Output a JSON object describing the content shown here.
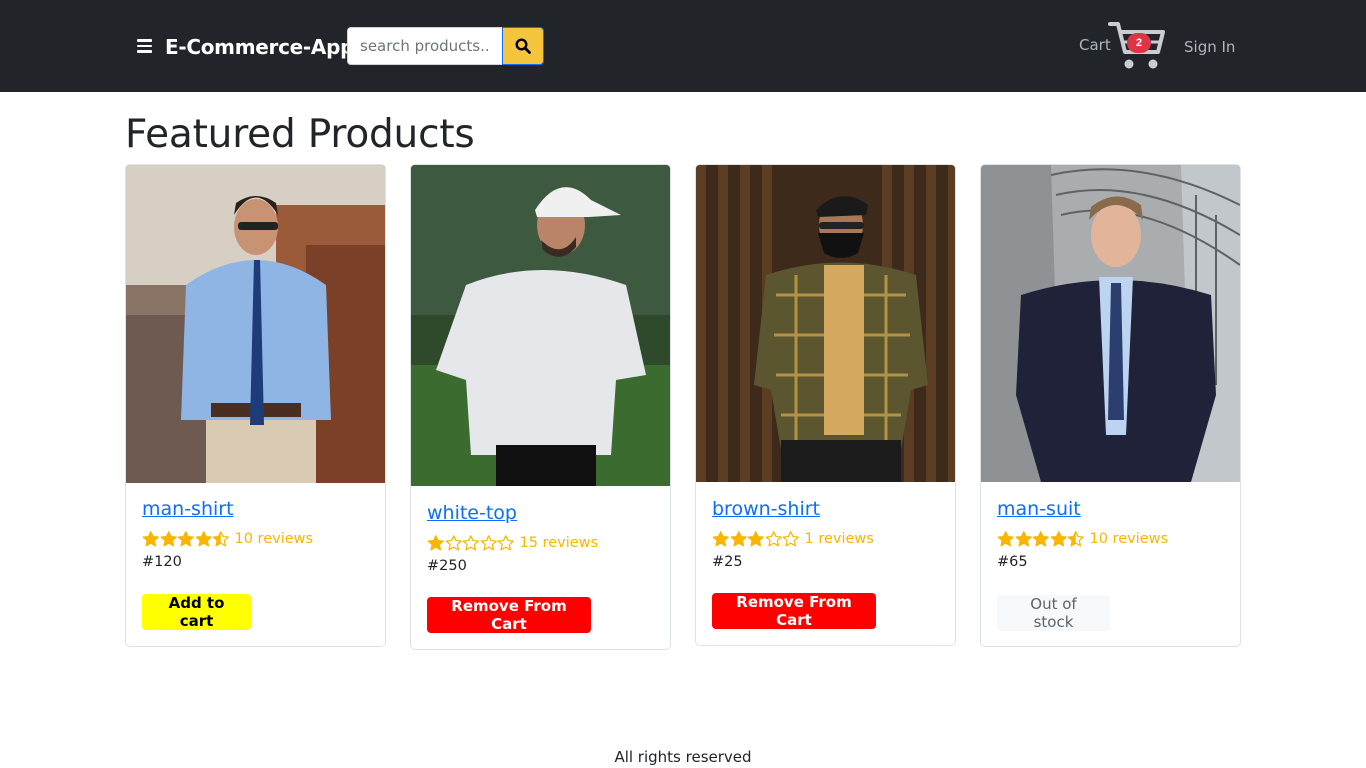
{
  "app": {
    "brand": "E-Commerce-App",
    "search_placeholder": "search products...",
    "cart_label": "Cart",
    "cart_count": "2",
    "signin_label": "Sign In"
  },
  "page": {
    "title": "Featured Products"
  },
  "products": [
    {
      "name": "man-shirt",
      "rating": 4.5,
      "reviews": "10 reviews",
      "price": "#120",
      "action": "Add to cart",
      "action_type": "add",
      "image": "man-in-blue-shirt-photo"
    },
    {
      "name": "white-top",
      "rating": 1,
      "reviews": "15 reviews",
      "price": "#250",
      "action": "Remove From Cart",
      "action_type": "remove",
      "image": "man-in-white-tee-photo"
    },
    {
      "name": "brown-shirt",
      "rating": 3,
      "reviews": "1 reviews",
      "price": "#25",
      "action": "Remove From Cart",
      "action_type": "remove",
      "image": "man-in-plaid-shirt-photo"
    },
    {
      "name": "man-suit",
      "rating": 4.5,
      "reviews": "10 reviews",
      "price": "#65",
      "action": "Out of stock",
      "action_type": "out-of-stock",
      "image": "man-in-navy-suit-photo"
    }
  ],
  "footer": {
    "text": "All rights reserved"
  },
  "colors": {
    "navbar_bg": "#212529",
    "search_button": "#f4c53d",
    "link_blue": "#0d6efd",
    "star_gold": "#f8b600",
    "add_button": "#ffff00",
    "remove_button": "#ff0000",
    "cart_badge": "#dc3545"
  }
}
